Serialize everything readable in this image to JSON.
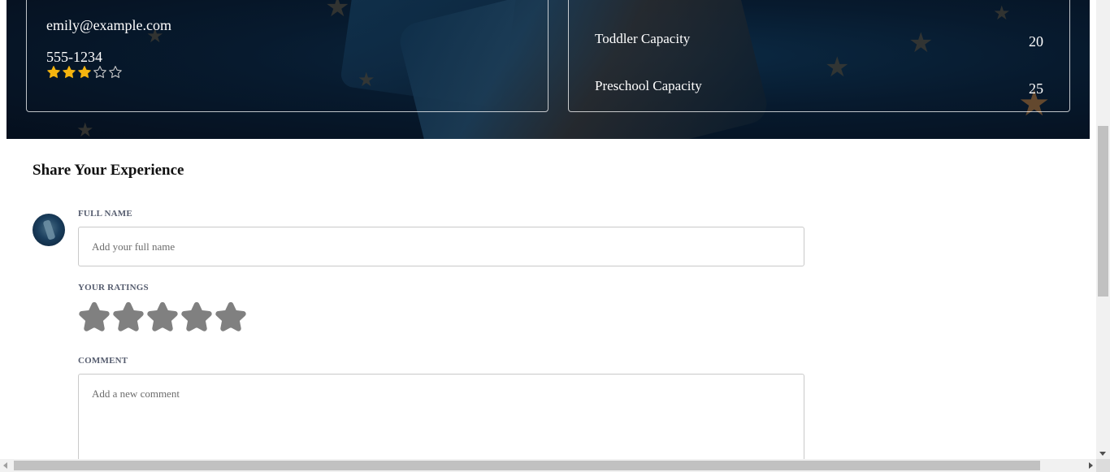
{
  "contact": {
    "email": "emily@example.com",
    "phone": "555-1234",
    "rating": 3,
    "rating_max": 5
  },
  "capacity": {
    "items": [
      {
        "label": "Toddler Capacity",
        "value": "20"
      },
      {
        "label": "Preschool Capacity",
        "value": "25"
      }
    ]
  },
  "review_form": {
    "title": "Share Your Experience",
    "name_label": "FULL NAME",
    "name_placeholder": "Add your full name",
    "ratings_label": "YOUR RATINGS",
    "rating_value": 0,
    "rating_max": 5,
    "comment_label": "COMMENT",
    "comment_placeholder": "Add a new comment"
  },
  "colors": {
    "star_filled": "#f5b40f",
    "star_empty_outline": "#cfcfcf",
    "star_input": "#808080",
    "hero_bg": "#071a2e"
  },
  "icons": {
    "star": "star-icon",
    "avatar": "user-avatar"
  }
}
